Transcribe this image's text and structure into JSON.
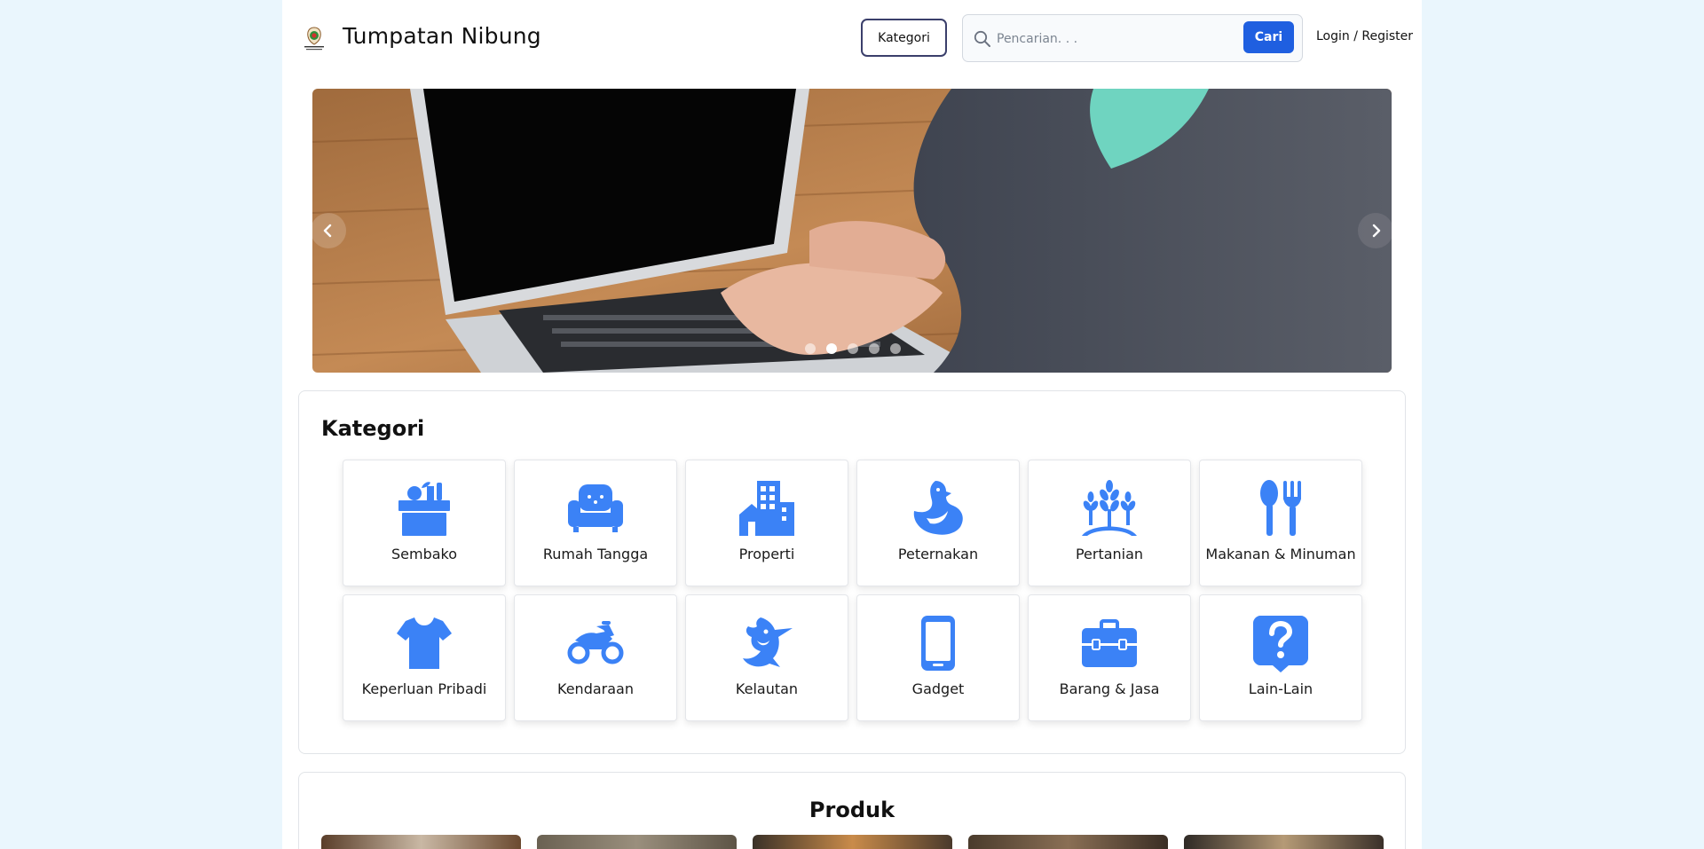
{
  "header": {
    "brand": "Tumpatan Nibung",
    "kategori_label": "Kategori",
    "search_placeholder": "Pencarian. . .",
    "search_value": "",
    "search_button": "Cari",
    "login_label": "Login / Register"
  },
  "carousel": {
    "slide_count": 5,
    "active_index": 1,
    "prev_icon": "chevron-left-icon",
    "next_icon": "chevron-right-icon"
  },
  "categories": {
    "title": "Kategori",
    "items": [
      {
        "label": "Sembako",
        "icon": "grocery-box-icon"
      },
      {
        "label": "Rumah Tangga",
        "icon": "armchair-icon"
      },
      {
        "label": "Properti",
        "icon": "building-icon"
      },
      {
        "label": "Peternakan",
        "icon": "chicken-icon"
      },
      {
        "label": "Pertanian",
        "icon": "wheat-icon"
      },
      {
        "label": "Makanan & Minuman",
        "icon": "spoon-fork-icon"
      },
      {
        "label": "Keperluan Pribadi",
        "icon": "tshirt-icon"
      },
      {
        "label": "Kendaraan",
        "icon": "motorcycle-icon"
      },
      {
        "label": "Kelautan",
        "icon": "fish-icon"
      },
      {
        "label": "Gadget",
        "icon": "smartphone-icon"
      },
      {
        "label": "Barang & Jasa",
        "icon": "toolbox-icon"
      },
      {
        "label": "Lain-Lain",
        "icon": "question-icon"
      }
    ]
  },
  "products": {
    "title": "Produk"
  },
  "colors": {
    "accent": "#1f5fe0",
    "icon_blue": "#3b82f6",
    "page_bg": "#eaf6fd"
  }
}
